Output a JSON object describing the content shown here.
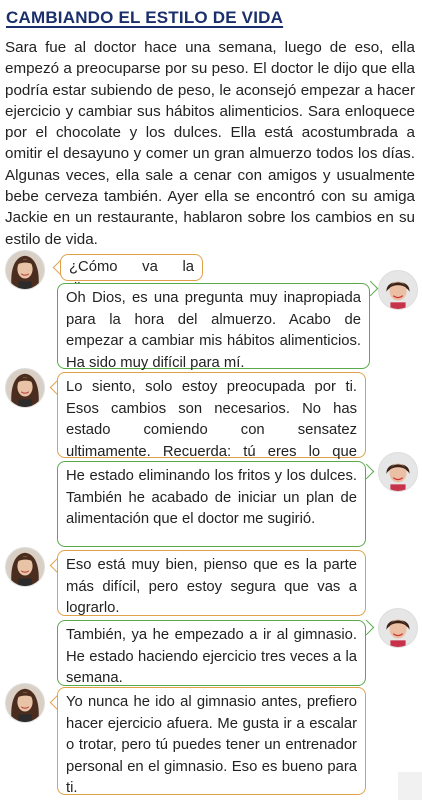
{
  "title": "CAMBIANDO EL ESTILO DE VIDA",
  "intro": "Sara fue al doctor hace una semana, luego de eso, ella empezó a preocuparse por su peso. El doctor le dijo que ella podría estar subiendo de peso, le aconsejó empezar a hacer ejercicio y cambiar sus hábitos alimenticios. Sara enloquece por el chocolate y los dulces. Ella está acostumbrada a omitir el desayuno y comer un gran almuerzo todos los días. Algunas veces, ella sale a cenar con amigos y usualmente bebe cerveza también. Ayer ella se encontró con su amiga Jackie en un restaurante, hablaron sobre los cambios en su estilo de vida.",
  "dialogue": [
    {
      "speaker": "sara",
      "text": "¿Cómo va la dieta?"
    },
    {
      "speaker": "jackie",
      "text": "Oh Dios, es una pregunta muy inapropiada para la hora del almuerzo. Acabo de empezar a cambiar mis hábitos alimenticios. Ha sido muy difícil para mí."
    },
    {
      "speaker": "sara",
      "text": "Lo siento, solo estoy preocupada por ti. Esos cambios son necesarios. No has estado comiendo con sensatez ultimamente. Recuerda: tú eres lo que comes."
    },
    {
      "speaker": "jackie",
      "text": "He estado eliminando los fritos y los dulces. También he acabado de iniciar un plan de alimentación que el doctor me sugirió."
    },
    {
      "speaker": "sara",
      "text": "Eso está muy bien, pienso que es la parte más difícil, pero estoy segura que vas a lograrlo."
    },
    {
      "speaker": "jackie",
      "text": "También, ya he empezado a ir al gimnasio. He estado haciendo ejercicio tres veces a la semana."
    },
    {
      "speaker": "sara",
      "text": "Yo nunca he ido al gimnasio antes, prefiero hacer ejercicio afuera. Me gusta ir a escalar o trotar, pero tú puedes tener un entrenador personal en el gimnasio. Eso es bueno para ti."
    }
  ],
  "colors": {
    "title": "#1a2f6b",
    "sara_border": "#e0a14a",
    "jackie_border": "#5aaa4c"
  },
  "icons": {
    "sara": "woman-long-brown-hair-avatar",
    "jackie": "woman-short-dark-hair-avatar"
  }
}
